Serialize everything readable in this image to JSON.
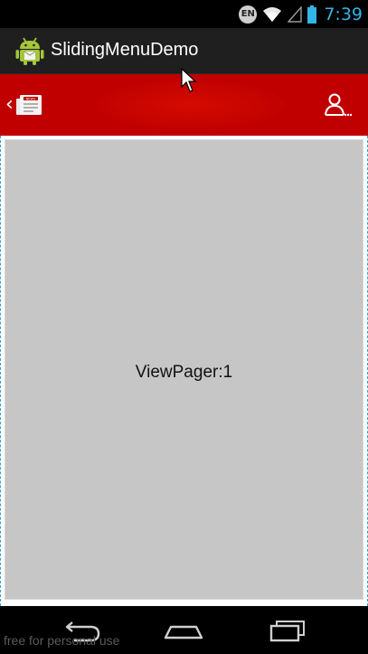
{
  "status_bar": {
    "language": "EN",
    "time": "7:39"
  },
  "action_bar": {
    "title": "SlidingMenuDemo"
  },
  "header": {
    "back_glyph": "‹",
    "left_icon": "news-icon",
    "right_icon": "user-icon"
  },
  "content": {
    "pager_label": "ViewPager:1"
  },
  "nav_bar": {
    "buttons": [
      "back-icon",
      "home-icon",
      "recent-apps-icon"
    ]
  },
  "watermark": {
    "text": "free for personal use"
  },
  "colors": {
    "header_red": "#c00000",
    "clock_blue": "#33b5e5",
    "pager_gray": "#c6c6c6"
  }
}
